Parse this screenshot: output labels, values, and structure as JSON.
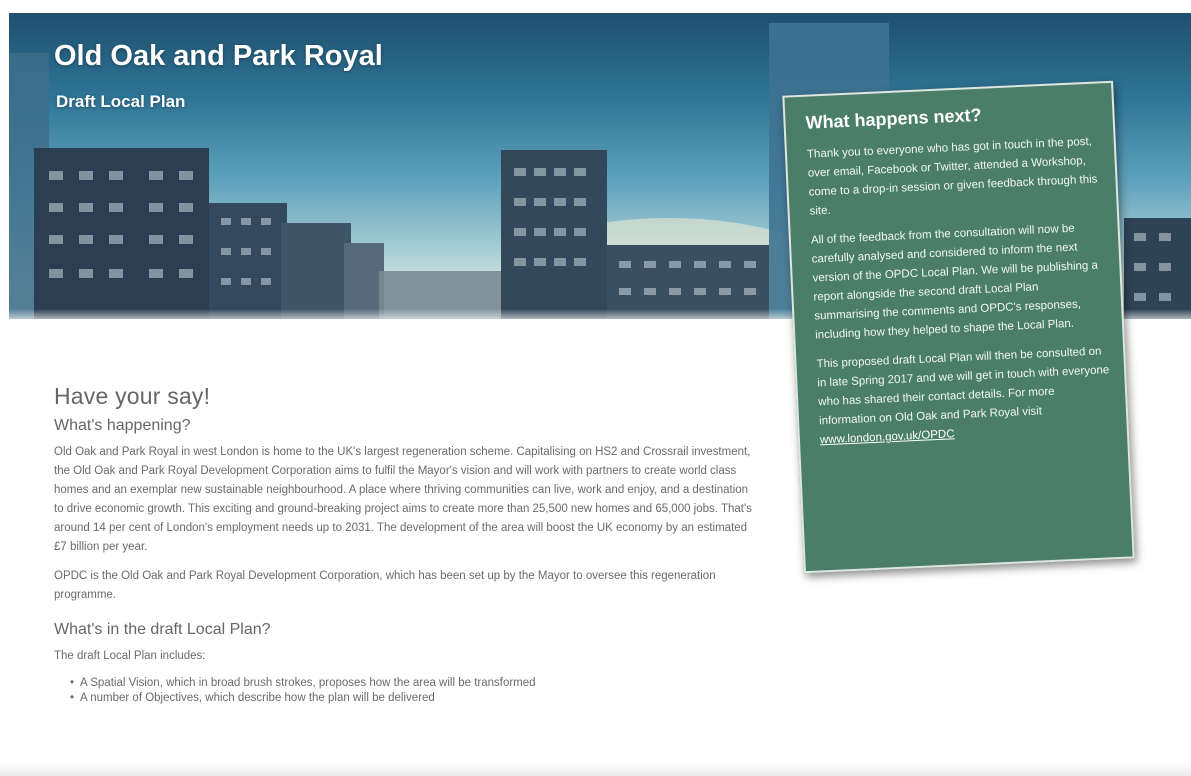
{
  "hero": {
    "title": "Old Oak and Park Royal",
    "subtitle": "Draft Local Plan"
  },
  "main": {
    "page_heading": "Have your say!",
    "section1_heading": "What's happening?",
    "section1_para1": "Old Oak and Park Royal in west London is home to the UK's largest regeneration scheme. Capitalising on HS2 and Crossrail investment, the Old Oak and Park Royal Development Corporation aims to fulfil the Mayor's vision and will work with partners to create world class homes and an exemplar new sustainable neighbourhood. A place where thriving communities can live, work and enjoy, and a destination to drive economic growth. This exciting and ground-breaking project aims to create more than 25,500 new homes and 65,000 jobs. That's around 14 per cent of London's employment needs up to 2031. The development of the area will boost the UK economy by an estimated £7 billion per year.",
    "section1_para2": "OPDC is the Old Oak and Park Royal Development Corporation, which has been set up by the Mayor to oversee this regeneration programme.",
    "section2_heading": "What's in the draft Local Plan?",
    "section2_intro": "The draft Local Plan includes:",
    "bullets": [
      "A Spatial Vision, which in broad brush strokes, proposes how the area will be transformed",
      "A number of Objectives, which describe how the plan will be delivered"
    ]
  },
  "card": {
    "title": "What happens next?",
    "para1": "Thank you to everyone who has got in touch in the post, over email, Facebook or Twitter, attended a Workshop, come to a drop-in session or given feedback through this site.",
    "para2": "All of the feedback from the consultation will now be carefully analysed and considered to inform the next version of the OPDC Local Plan. We will be publishing a report alongside the second draft Local Plan summarising the comments and OPDC's responses, including how they helped to shape the Local Plan.",
    "para3": "This proposed draft Local Plan will then be consulted on in late Spring 2017 and we will get in touch with everyone who has shared their contact details. For more information on Old Oak and Park Royal visit",
    "link": "www.london.gov.uk/OPDC"
  },
  "colors": {
    "card_background": "#4a7e69",
    "body_text": "#6a6a6a"
  }
}
